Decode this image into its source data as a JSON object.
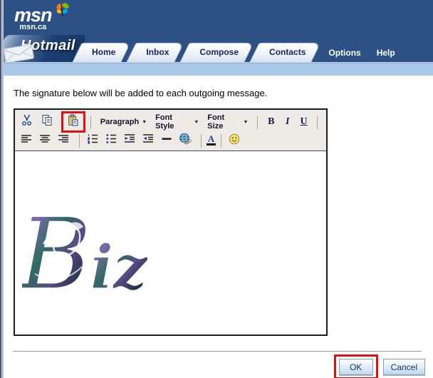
{
  "colors": {
    "header_blue": "#2d5184",
    "light_blue_bar": "#a9c7e6",
    "tab_text": "#16246e",
    "toolbar_bg": "#eeebe6",
    "highlight_red": "#e01010",
    "button_text": "#17356b"
  },
  "header": {
    "msn_logo": "msn",
    "msn_region": "msn.ca",
    "product": "Hotmail",
    "tabs": [
      {
        "label": "Home"
      },
      {
        "label": "Inbox"
      },
      {
        "label": "Compose"
      },
      {
        "label": "Contacts"
      }
    ],
    "menu_links": [
      {
        "label": "Options"
      },
      {
        "label": "Help"
      }
    ]
  },
  "main": {
    "intro_text": "The signature below will be added to each outgoing message.",
    "editor": {
      "dropdowns": [
        {
          "label": "Paragraph"
        },
        {
          "label": "Font Style"
        },
        {
          "label": "Font Size"
        }
      ],
      "dropdown_arrow": "▼",
      "bold_label": "B",
      "italic_label": "I",
      "underline_label": "U",
      "font_color_label": "A",
      "signature_initial": "B",
      "signature_rest": "iz"
    },
    "buttons": {
      "ok_label": "OK",
      "cancel_label": "Cancel"
    }
  }
}
